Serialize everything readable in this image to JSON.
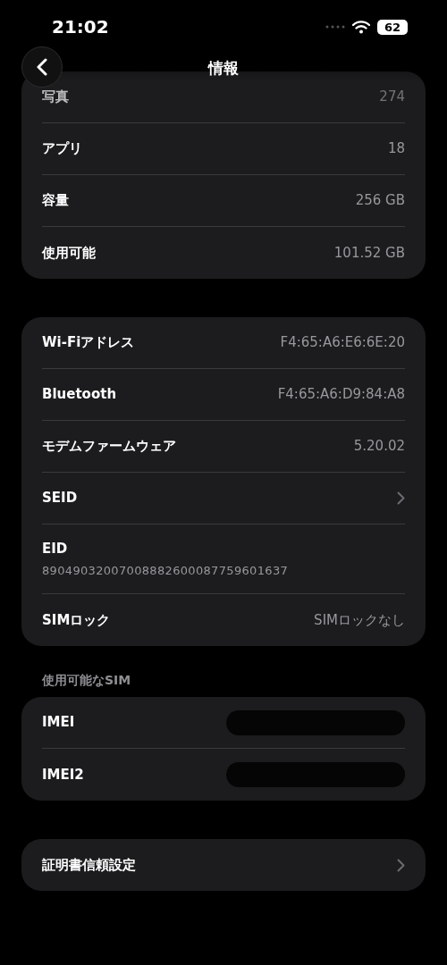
{
  "status_bar": {
    "time": "21:02",
    "battery": "62"
  },
  "nav": {
    "title": "情報"
  },
  "groups": [
    {
      "rows": [
        {
          "kind": "value",
          "label": "写真",
          "value": "274",
          "faded": true
        },
        {
          "kind": "value",
          "label": "アプリ",
          "value": "18",
          "faded": false
        },
        {
          "kind": "value",
          "label": "容量",
          "value": "256 GB",
          "faded": false
        },
        {
          "kind": "value",
          "label": "使用可能",
          "value": "101.52 GB",
          "faded": false
        }
      ]
    },
    {
      "rows": [
        {
          "kind": "value",
          "label": "Wi-Fiアドレス",
          "value": "F4:65:A6:E6:6E:20",
          "faded": false
        },
        {
          "kind": "value",
          "label": "Bluetooth",
          "value": "F4:65:A6:D9:84:A8",
          "faded": false
        },
        {
          "kind": "value",
          "label": "モデムファームウェア",
          "value": "5.20.02",
          "faded": false
        },
        {
          "kind": "link",
          "label": "SEID",
          "faded": false
        },
        {
          "kind": "stacked",
          "label": "EID",
          "value": "89049032007008882600087759601637",
          "faded": false
        },
        {
          "kind": "value",
          "label": "SIMロック",
          "value": "SIMロックなし",
          "faded": false
        }
      ]
    },
    {
      "header": "使用可能なSIM",
      "rows": [
        {
          "kind": "redacted",
          "label": "IMEI",
          "faded": false
        },
        {
          "kind": "redacted",
          "label": "IMEI2",
          "faded": false
        }
      ]
    },
    {
      "rows": [
        {
          "kind": "link",
          "label": "証明書信頼設定",
          "faded": false
        }
      ]
    }
  ]
}
